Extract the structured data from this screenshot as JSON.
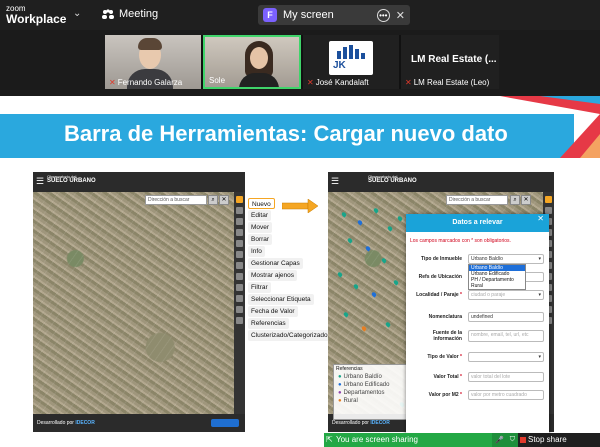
{
  "topbar": {
    "brand_line1": "zoom",
    "brand_line2": "Workplace",
    "brand_chevron": "⌄",
    "meeting_label": "Meeting",
    "share_tab": {
      "badge": "F",
      "label": "My screen",
      "more": "•••",
      "close": "✕"
    }
  },
  "participants": [
    {
      "name": "Fernando Galarza",
      "muted": true
    },
    {
      "name": "Sole",
      "muted": false,
      "active_speaker": true
    },
    {
      "name": "José Kandalaft",
      "muted": true
    },
    {
      "name": "LM Real Estate (Leo)",
      "display_title": "LM Real Estate (...",
      "muted": true
    }
  ],
  "slide": {
    "title": "Barra de Herramientas: Cargar nuevo dato",
    "left_app": {
      "logo_line1": "Observatorio del",
      "logo_line2": "SUELO URBANO",
      "search_placeholder": "Dirección a buscar",
      "footer": {
        "prefix": "Desarrollado por",
        "org": "IDECOR"
      }
    },
    "tools_menu": [
      "Nuevo",
      "Editar",
      "Mover",
      "Borrar",
      "Info",
      "Gestionar Capas",
      "Mostrar ajenos",
      "Filtrar",
      "Seleccionar Etiqueta",
      "Fecha de Valor",
      "Referencias",
      "Clusterizado/Categorizado"
    ],
    "highlighted_tool": "Nuevo",
    "right_app": {
      "logo_line1": "Observatorio del",
      "logo_line2": "SUELO URBANO",
      "search_placeholder": "Dirección a buscar",
      "footer": {
        "prefix": "Desarrollado por",
        "org": "IDECOR"
      },
      "legend": {
        "title": "Referencias",
        "items": [
          {
            "label": "Urbano Baldío",
            "color": "#18a58a"
          },
          {
            "label": "Urbano Edificado",
            "color": "#1e6fd9"
          },
          {
            "label": "Departamentos",
            "color": "#8e44ad"
          },
          {
            "label": "Rural",
            "color": "#e67e22"
          }
        ]
      },
      "dialog": {
        "title": "Datos a relevar",
        "close": "✕",
        "required_note": "Los campos marcados con * son obligatorios.",
        "fields": [
          {
            "label": "Tipo de Inmueble",
            "value": "Urbano Baldío",
            "placeholder": ""
          },
          {
            "label": "Refs de Ubicación",
            "value": "",
            "placeholder": ""
          },
          {
            "label": "Localidad / Paraje",
            "value": "",
            "placeholder": "ciudad o paraje"
          },
          {
            "label": "Nomenclatura",
            "value": "undefined",
            "placeholder": ""
          },
          {
            "label": "Fuente de la información",
            "value": "",
            "placeholder": "nombre, email, tel, url, etc"
          },
          {
            "label": "Tipo de Valor",
            "value": "",
            "placeholder": ""
          },
          {
            "label": "Valor Total",
            "value": "",
            "placeholder": "valor total del lote"
          },
          {
            "label": "Valor por M2",
            "value": "",
            "placeholder": "valor por metro cuadrado"
          }
        ],
        "dropdown_options": [
          "Urbano Baldío",
          "Urbano Edificado",
          "PH / Departamento",
          "Rural"
        ],
        "dropdown_selected": "Urbano Baldío"
      }
    }
  },
  "sharebar": {
    "status": "You are screen sharing",
    "stop_label": "Stop share"
  },
  "colors": {
    "banner": "#2aa8de",
    "dialog_header": "#1aa3d9",
    "share_green": "#23a845",
    "stop_red": "#e0392b"
  }
}
